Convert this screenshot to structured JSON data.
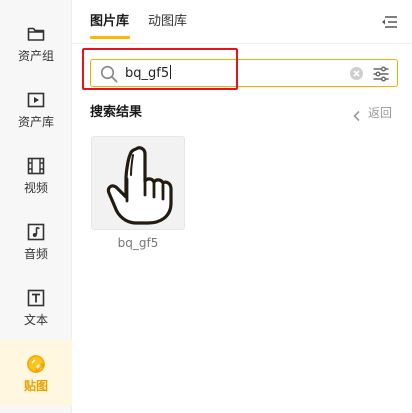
{
  "sidebar": {
    "items": [
      {
        "label": "资产组",
        "icon": "folder-icon"
      },
      {
        "label": "资产库",
        "icon": "play-box-icon"
      },
      {
        "label": "视频",
        "icon": "film-icon"
      },
      {
        "label": "音频",
        "icon": "music-note-icon"
      },
      {
        "label": "文本",
        "icon": "text-t-icon"
      },
      {
        "label": "贴图",
        "icon": "sticker-icon",
        "active": true
      }
    ]
  },
  "tabs": [
    {
      "label": "图片库",
      "active": true
    },
    {
      "label": "动图库",
      "active": false
    }
  ],
  "search": {
    "value": "bq_gf5"
  },
  "results": {
    "title": "搜索结果",
    "back_label": "返回",
    "items": [
      {
        "label": "bq_gf5",
        "icon": "pointing-hand-icon"
      }
    ]
  },
  "colors": {
    "accent": "#ffb800",
    "highlight": "#e2151e"
  }
}
